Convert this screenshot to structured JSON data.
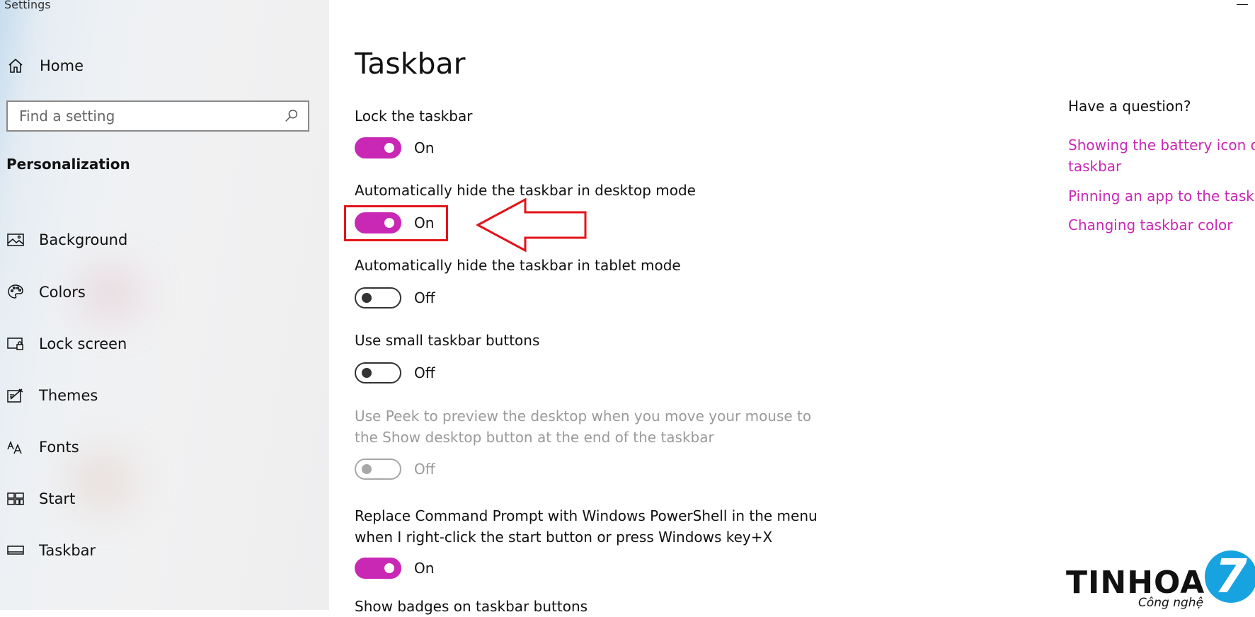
{
  "window": {
    "title": "Settings"
  },
  "sidebar": {
    "home_label": "Home",
    "search_placeholder": "Find a setting",
    "section_title": "Personalization",
    "items": [
      {
        "label": "Background",
        "icon": "picture-icon"
      },
      {
        "label": "Colors",
        "icon": "palette-icon"
      },
      {
        "label": "Lock screen",
        "icon": "lock-screen-icon"
      },
      {
        "label": "Themes",
        "icon": "themes-icon"
      },
      {
        "label": "Fonts",
        "icon": "fonts-icon"
      },
      {
        "label": "Start",
        "icon": "start-icon"
      },
      {
        "label": "Taskbar",
        "icon": "taskbar-icon"
      }
    ]
  },
  "main": {
    "title": "Taskbar",
    "settings": [
      {
        "label": "Lock the taskbar",
        "state": "On",
        "enabled": true
      },
      {
        "label": "Automatically hide the taskbar in desktop mode",
        "state": "On",
        "enabled": true
      },
      {
        "label": "Automatically hide the taskbar in tablet mode",
        "state": "Off",
        "enabled": true
      },
      {
        "label": "Use small taskbar buttons",
        "state": "Off",
        "enabled": true
      },
      {
        "label_line1": "Use Peek to preview the desktop when you move your mouse to",
        "label_line2": "the Show desktop button at the end of the taskbar",
        "state": "Off",
        "enabled": false
      },
      {
        "label_line1": "Replace Command Prompt with Windows PowerShell in the menu",
        "label_line2": "when I right-click the start button or press Windows key+X",
        "state": "On",
        "enabled": true
      },
      {
        "label": "Show badges on taskbar buttons"
      }
    ]
  },
  "help": {
    "title": "Have a question?",
    "links": [
      {
        "line1": "Showing the battery icon o",
        "line2": "taskbar"
      },
      {
        "line1": "Pinning an app to the taskb"
      },
      {
        "line1": "Changing taskbar color"
      }
    ]
  },
  "watermark": {
    "brand": "TINHOA",
    "sub": "Công nghệ",
    "badge": "7"
  },
  "colors": {
    "accent": "#c828b4",
    "annotation": "#e3141a",
    "logo_blue": "#16a3e0"
  }
}
